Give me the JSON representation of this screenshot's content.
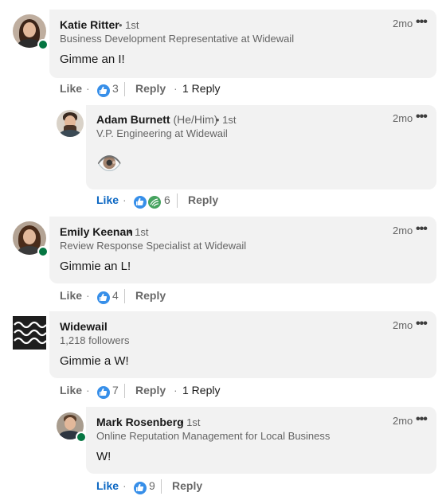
{
  "comments": [
    {
      "name": "Katie Ritter",
      "degree": "• 1st",
      "headline": "Business Development Representative at Widewail",
      "time": "2mo",
      "text": "Gimme an I!",
      "like_label": "Like",
      "reaction_count": "3",
      "reply_label": "Reply",
      "replies_count": "1 Reply"
    },
    {
      "name": "Adam Burnett",
      "pronouns": "(He/Him)",
      "degree": "• 1st",
      "headline": "V.P. Engineering at Widewail",
      "time": "2mo",
      "text": "👁️",
      "like_label": "Like",
      "reaction_count": "6",
      "reply_label": "Reply"
    },
    {
      "name": "Emily Keenan",
      "degree": "• 1st",
      "headline": "Review Response Specialist at Widewail",
      "time": "2mo",
      "text": "Gimmie an L!",
      "like_label": "Like",
      "reaction_count": "4",
      "reply_label": "Reply"
    },
    {
      "name": "Widewail",
      "headline": "1,218 followers",
      "time": "2mo",
      "text": "Gimmie a W!",
      "like_label": "Like",
      "reaction_count": "7",
      "reply_label": "Reply",
      "replies_count": "1 Reply"
    },
    {
      "name": "Mark Rosenberg",
      "degree": "• 1st",
      "headline": "Online Reputation Management for Local Business",
      "time": "2mo",
      "text": "W!",
      "like_label": "Like",
      "reaction_count": "9",
      "reply_label": "Reply"
    }
  ],
  "separators": {
    "dot": "·"
  },
  "icons": {
    "more": "more-horizontal-icon",
    "like_reaction": "like-reaction-icon",
    "support_reaction": "support-reaction-icon"
  },
  "colors": {
    "bubble": "#f2f2f2",
    "link_blue": "#0a66c2",
    "online_green": "#057642"
  }
}
